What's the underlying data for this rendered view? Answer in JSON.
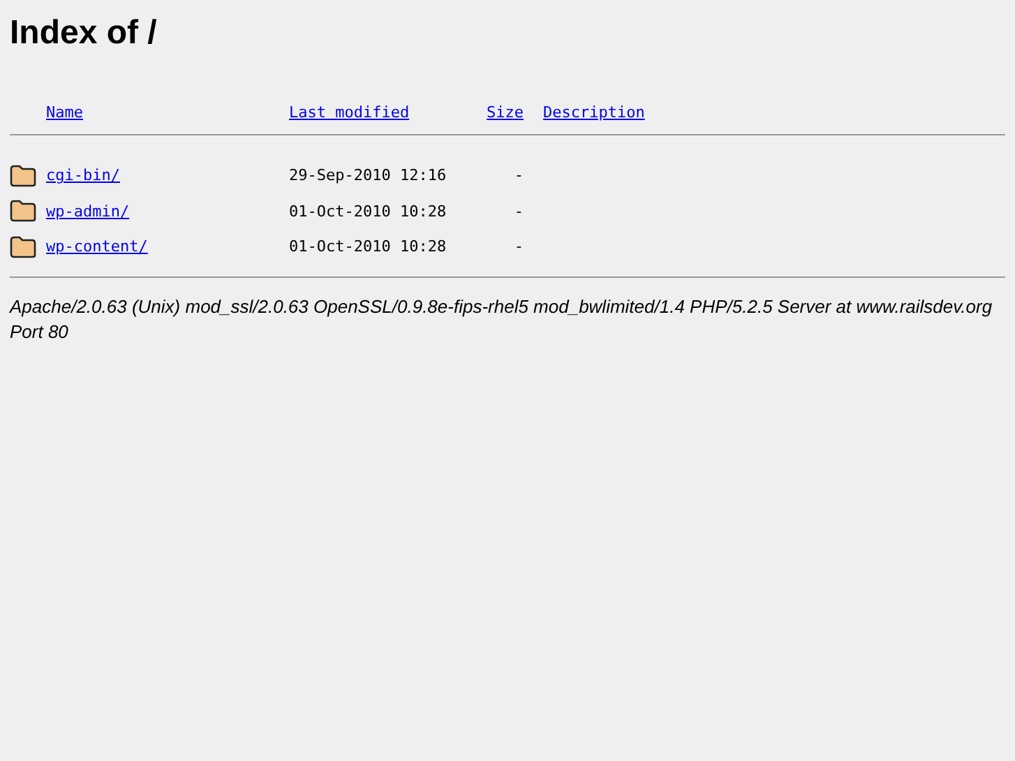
{
  "title": "Index of /",
  "columns": [
    "Name",
    "Last modified",
    "Size",
    "Description"
  ],
  "rows": [
    {
      "name": "cgi-bin/",
      "modified": "29-Sep-2010 12:16",
      "size": "-"
    },
    {
      "name": "wp-admin/",
      "modified": "01-Oct-2010 10:28",
      "size": "-"
    },
    {
      "name": "wp-content/",
      "modified": "01-Oct-2010 10:28",
      "size": "-"
    }
  ],
  "address": "Apache/2.0.63 (Unix) mod_ssl/2.0.63 OpenSSL/0.9.8e-fips-rhel5 mod_bwlimited/1.4 PHP/5.2.5 Server at www.railsdev.org Port 80"
}
